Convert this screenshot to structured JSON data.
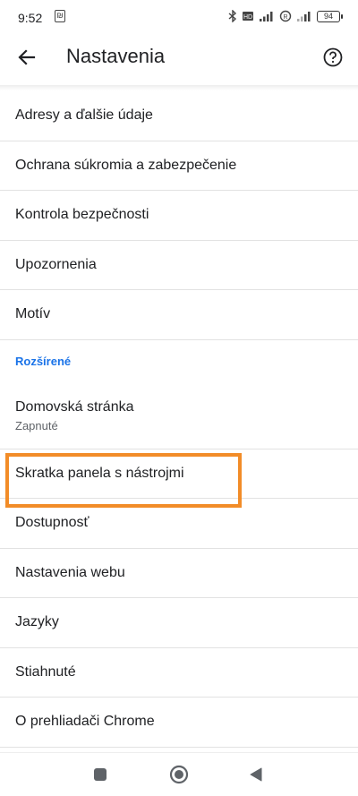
{
  "status_bar": {
    "time": "9:52",
    "battery": "94"
  },
  "app_bar": {
    "title": "Nastavenia"
  },
  "settings": {
    "items": [
      {
        "label": "Adresy a ďalšie údaje"
      },
      {
        "label": "Ochrana súkromia a zabezpečenie"
      },
      {
        "label": "Kontrola bezpečnosti"
      },
      {
        "label": "Upozornenia"
      },
      {
        "label": "Motív"
      }
    ],
    "advanced_header": "Rozšírené",
    "advanced_items": [
      {
        "label": "Domovská stránka",
        "subtitle": "Zapnuté"
      },
      {
        "label": "Skratka panela s nástrojmi",
        "highlighted": true
      },
      {
        "label": "Dostupnosť"
      },
      {
        "label": "Nastavenia webu"
      },
      {
        "label": "Jazyky"
      },
      {
        "label": "Stiahnuté"
      },
      {
        "label": "O prehliadači Chrome"
      }
    ]
  },
  "colors": {
    "accent": "#1a73e8",
    "highlight": "#f28c28"
  },
  "icons": {
    "back": "arrow-back-icon",
    "help": "help-icon",
    "nav_recents": "square-icon",
    "nav_home": "circle-icon",
    "nav_back": "triangle-back-icon"
  }
}
